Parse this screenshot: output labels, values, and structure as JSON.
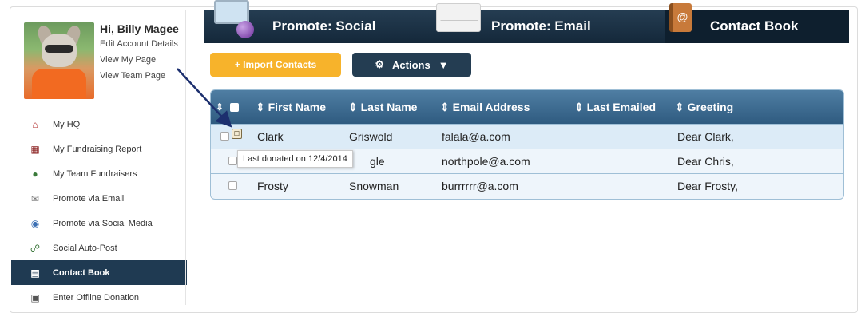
{
  "profile": {
    "greeting": "Hi, Billy Magee",
    "links": [
      "Edit Account Details",
      "View My Page",
      "View Team Page"
    ]
  },
  "sidebar": {
    "items": [
      {
        "label": "My HQ",
        "icon": "house-icon"
      },
      {
        "label": "My Fundraising Report",
        "icon": "report-icon"
      },
      {
        "label": "My Team Fundraisers",
        "icon": "team-icon"
      },
      {
        "label": "Promote via Email",
        "icon": "envelope-icon"
      },
      {
        "label": "Promote via Social Media",
        "icon": "globe-icon"
      },
      {
        "label": "Social Auto-Post",
        "icon": "share-icon"
      },
      {
        "label": "Contact Book",
        "icon": "address-book-icon",
        "active": true
      },
      {
        "label": "Enter Offline Donation",
        "icon": "cash-register-icon"
      }
    ]
  },
  "tabs": [
    {
      "label": "Promote: Social"
    },
    {
      "label": "Promote: Email"
    },
    {
      "label": "Contact Book",
      "active": true
    }
  ],
  "toolbar": {
    "import_label": "+ Import Contacts",
    "actions_label": "Actions",
    "actions_caret": "▼"
  },
  "table": {
    "columns": [
      "First Name",
      "Last Name",
      "Email Address",
      "Last Emailed",
      "Greeting"
    ],
    "rows": [
      {
        "first": "Clark",
        "last": "Griswold",
        "email": "falala@a.com",
        "last_emailed": "",
        "greeting": "Dear Clark,"
      },
      {
        "first": "",
        "last": "gle",
        "email": "northpole@a.com",
        "last_emailed": "",
        "greeting": "Dear Chris,"
      },
      {
        "first": "Frosty",
        "last": "Snowman",
        "email": "burrrrrr@a.com",
        "last_emailed": "",
        "greeting": "Dear Frosty,"
      }
    ]
  },
  "tooltip": {
    "text": "Last donated on 12/4/2014"
  },
  "colors": {
    "navy": "#1f3a52",
    "header_blue": "#3d6a8f",
    "import_orange": "#f7b32b",
    "row_highlight": "#dcebf7"
  }
}
